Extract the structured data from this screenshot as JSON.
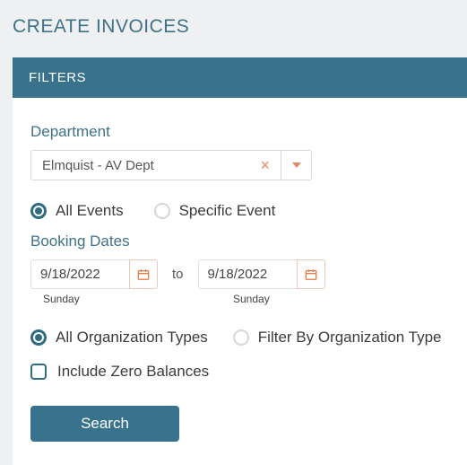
{
  "page": {
    "title": "CREATE INVOICES"
  },
  "panel": {
    "header": "FILTERS"
  },
  "department": {
    "label": "Department",
    "value": "Elmquist - AV Dept"
  },
  "eventScope": {
    "all": "All Events",
    "specific": "Specific Event",
    "selected": "all"
  },
  "bookingDates": {
    "label": "Booking Dates",
    "from": "9/18/2022",
    "fromDow": "Sunday",
    "to_label": "to",
    "to": "9/18/2022",
    "toDow": "Sunday"
  },
  "orgTypes": {
    "all": "All Organization Types",
    "filter": "Filter By Organization Type",
    "selected": "all"
  },
  "zeroBalances": {
    "label": "Include Zero Balances",
    "checked": false
  },
  "actions": {
    "search": "Search"
  }
}
